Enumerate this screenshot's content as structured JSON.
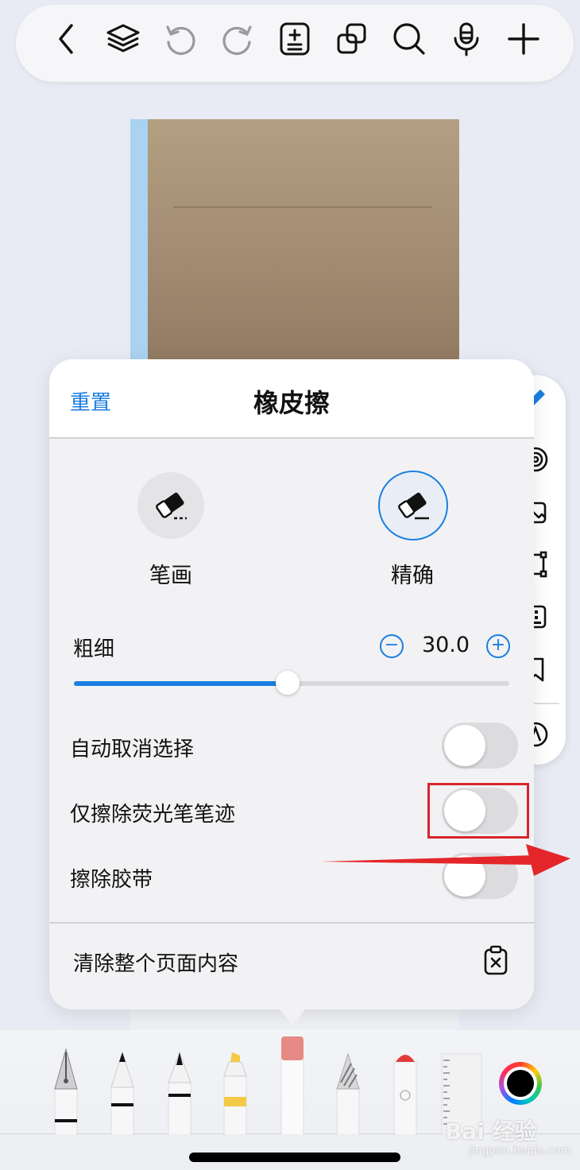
{
  "toolbar": {
    "icons": [
      "back-icon",
      "layers-icon",
      "undo-icon",
      "redo-icon",
      "page-add-icon",
      "copy-icon",
      "search-icon",
      "microphone-icon",
      "plus-icon"
    ]
  },
  "side_tools": [
    "pen-icon",
    "audio-icon",
    "image-icon",
    "shape-icon",
    "keyboard-icon",
    "bookmark-icon",
    "sticker-icon"
  ],
  "eraser_panel": {
    "reset_label": "重置",
    "title": "橡皮擦",
    "modes": [
      {
        "label": "笔画",
        "selected": false
      },
      {
        "label": "精确",
        "selected": true
      }
    ],
    "size_label": "粗细",
    "size_value": "30.0",
    "size_fraction": 0.49,
    "toggles": [
      {
        "label": "自动取消选择",
        "on": false
      },
      {
        "label": "仅擦除荧光笔笔迹",
        "on": false
      },
      {
        "label": "擦除胶带",
        "on": false
      }
    ],
    "clear_label": "清除整个页面内容"
  },
  "annotation_color": "#d9242c",
  "accent_color": "#1a7ee0",
  "tray": {
    "tools": [
      "fountain-pen",
      "pencil-tool",
      "ballpoint-pen",
      "highlighter",
      "eraser",
      "pattern-brush",
      "spray-marker",
      "ruler"
    ],
    "selected_color": "#000000"
  },
  "watermark": {
    "text": "Bai 经验",
    "sub": "jingyan.baidu.com"
  }
}
